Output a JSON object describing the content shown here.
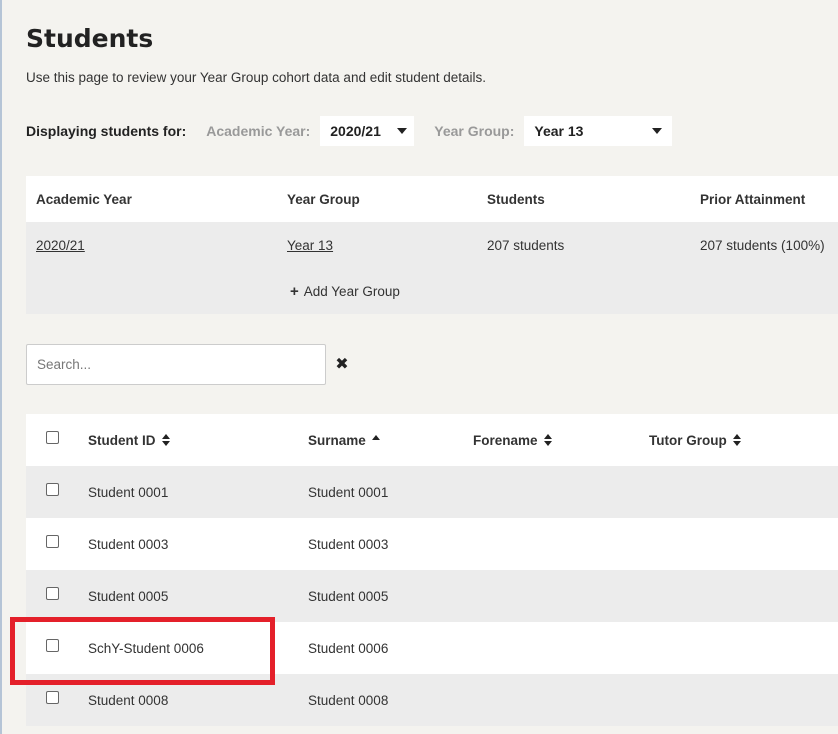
{
  "page": {
    "title": "Students",
    "description": "Use this page to review your Year Group cohort data and edit student details."
  },
  "filters": {
    "lead": "Displaying students for:",
    "academic_year_label": "Academic Year:",
    "academic_year_value": "2020/21",
    "year_group_label": "Year Group:",
    "year_group_value": "Year 13"
  },
  "summary": {
    "headers": [
      "Academic Year",
      "Year Group",
      "Students",
      "Prior Attainment"
    ],
    "row": {
      "academic_year": "2020/21",
      "year_group": "Year 13",
      "students": "207 students",
      "prior_attainment": "207 students (100%)"
    },
    "add_label": "Add Year Group"
  },
  "search": {
    "placeholder": "Search...",
    "value": ""
  },
  "students_table": {
    "headers": {
      "student_id": "Student ID",
      "surname": "Surname",
      "forename": "Forename",
      "tutor_group": "Tutor Group"
    },
    "sort": {
      "column": "surname",
      "direction": "ascending"
    },
    "rows": [
      {
        "student_id": "Student 0001",
        "surname": "Student 0001",
        "forename": "",
        "tutor_group": ""
      },
      {
        "student_id": "Student 0003",
        "surname": "Student 0003",
        "forename": "",
        "tutor_group": ""
      },
      {
        "student_id": "Student 0005",
        "surname": "Student 0005",
        "forename": "",
        "tutor_group": ""
      },
      {
        "student_id": "SchY-Student 0006",
        "surname": "Student 0006",
        "forename": "",
        "tutor_group": ""
      },
      {
        "student_id": "Student 0008",
        "surname": "Student 0008",
        "forename": "",
        "tutor_group": ""
      }
    ]
  },
  "colors": {
    "background": "#f4f3ef",
    "row_shade": "#ececec",
    "highlight": "#e4202a"
  },
  "icons": {
    "add": "plus-icon",
    "clear": "close-icon",
    "dropdown": "caret-down-icon",
    "sort": "sort-icon"
  }
}
